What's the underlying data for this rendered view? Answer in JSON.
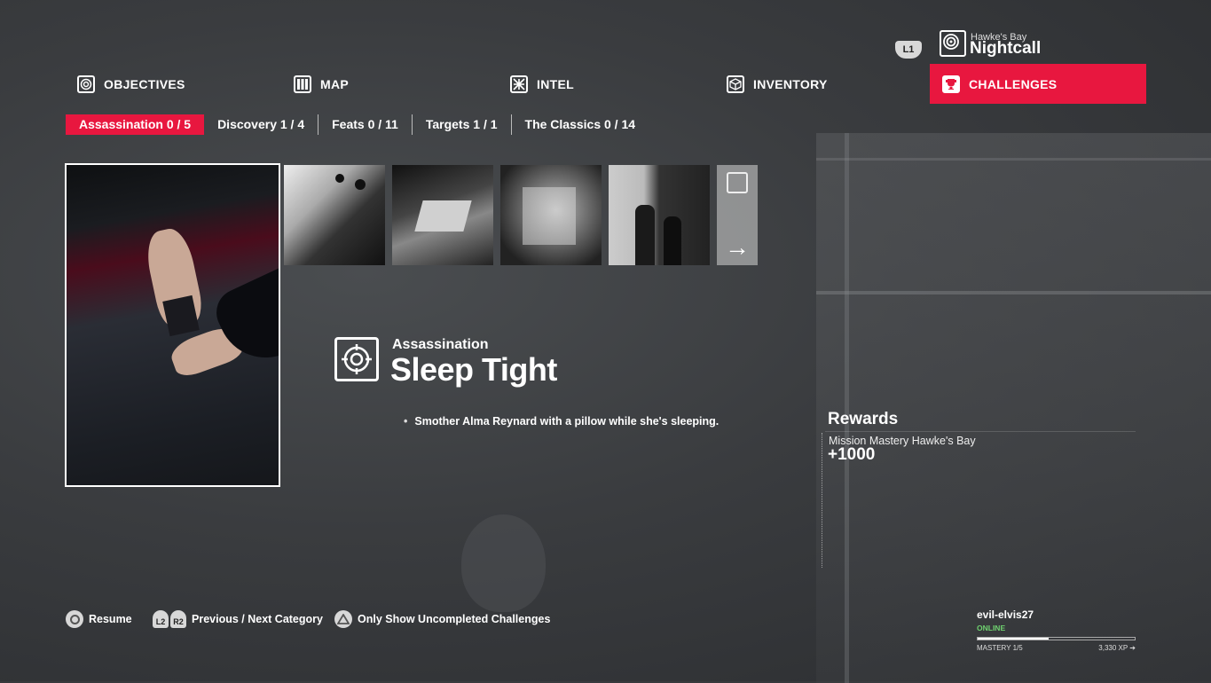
{
  "mission": {
    "controller_hint": "L1",
    "location": "Hawke's Bay",
    "name": "Nightcall"
  },
  "main_tabs": [
    {
      "label": "OBJECTIVES",
      "icon": "objectives-target-icon"
    },
    {
      "label": "MAP",
      "icon": "map-icon"
    },
    {
      "label": "INTEL",
      "icon": "intel-icon"
    },
    {
      "label": "INVENTORY",
      "icon": "inventory-box-icon"
    },
    {
      "label": "CHALLENGES",
      "icon": "trophy-icon",
      "active": true
    }
  ],
  "sub_tabs": [
    {
      "label": "Assassination  0 / 5",
      "active": true
    },
    {
      "label": "Discovery  1 / 4"
    },
    {
      "label": "Feats  0 / 11"
    },
    {
      "label": "Targets  1 / 1"
    },
    {
      "label": "The Classics  0 / 14"
    }
  ],
  "challenge": {
    "category": "Assassination",
    "title": "Sleep Tight",
    "description": "Smother Alma Reynard with a pillow while she's sleeping."
  },
  "rewards": {
    "title": "Rewards",
    "label": "Mission Mastery Hawke's Bay",
    "value": "+1000"
  },
  "controls": [
    {
      "buttons": [],
      "icon": "circle-button-icon",
      "label": "Resume"
    },
    {
      "buttons": [
        "L2",
        "R2"
      ],
      "label": "Previous / Next Category"
    },
    {
      "buttons": [],
      "icon": "triangle-button-icon",
      "label": "Only Show Uncompleted Challenges"
    }
  ],
  "profile": {
    "username": "evil-elvis27",
    "status": "ONLINE",
    "mastery": "MASTERY 1/5",
    "xp": "3,330 XP ➔",
    "progress": 0.45
  },
  "colors": {
    "accent": "#e8173f",
    "online": "#6fd26f"
  }
}
